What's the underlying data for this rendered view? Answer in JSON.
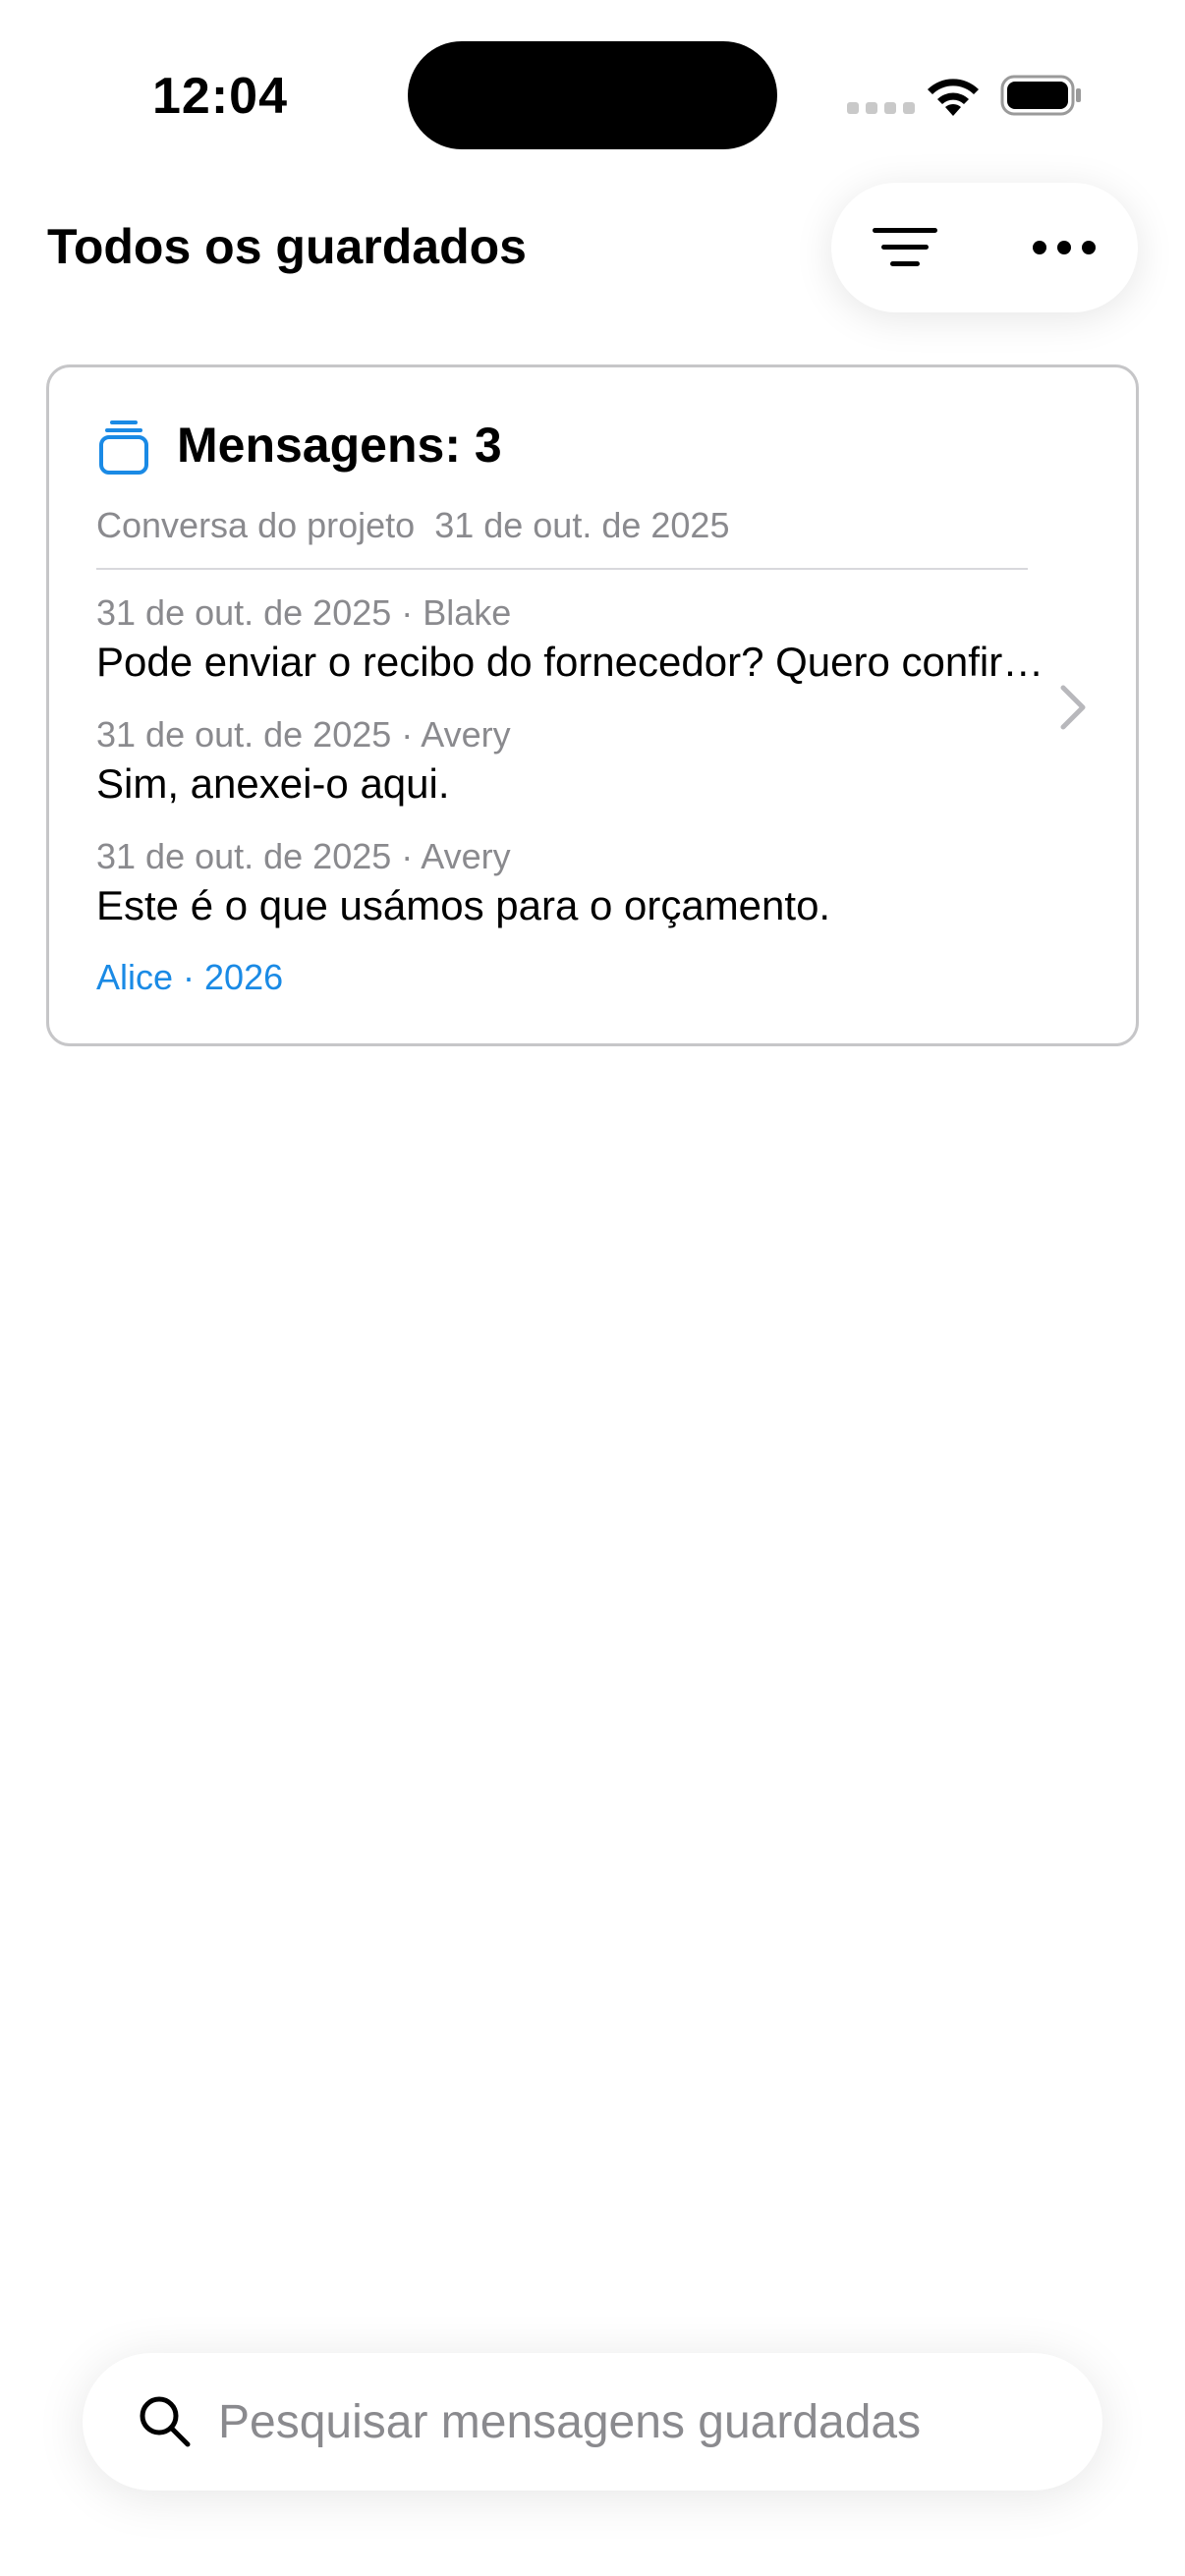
{
  "status_bar": {
    "time": "12:04",
    "icons": [
      "signal-icon",
      "wifi-icon",
      "battery-icon"
    ]
  },
  "header": {
    "title": "Todos os guardados",
    "actions": [
      "filter-icon",
      "more-icon"
    ]
  },
  "card": {
    "icon": "stack-icon",
    "title": "Mensagens: 3",
    "subtitle": "Conversa do projeto  31 de out. de 2025",
    "messages": [
      {
        "meta": "31 de out. de 2025 · Blake",
        "text": "Pode enviar o recibo do fornecedor? Quero confirmar os valores."
      },
      {
        "meta": "31 de out. de 2025 · Avery",
        "text": "Sim, anexei-o aqui."
      },
      {
        "meta": "31 de out. de 2025 · Avery",
        "text": "Este é o que usámos para o orçamento."
      }
    ],
    "footer": "Alice · 2026"
  },
  "search": {
    "placeholder": "Pesquisar mensagens guardadas",
    "value": ""
  },
  "colors": {
    "accent": "#1a8ae5",
    "secondary_text": "#8a8a8e",
    "card_border": "#c6c6c8"
  }
}
